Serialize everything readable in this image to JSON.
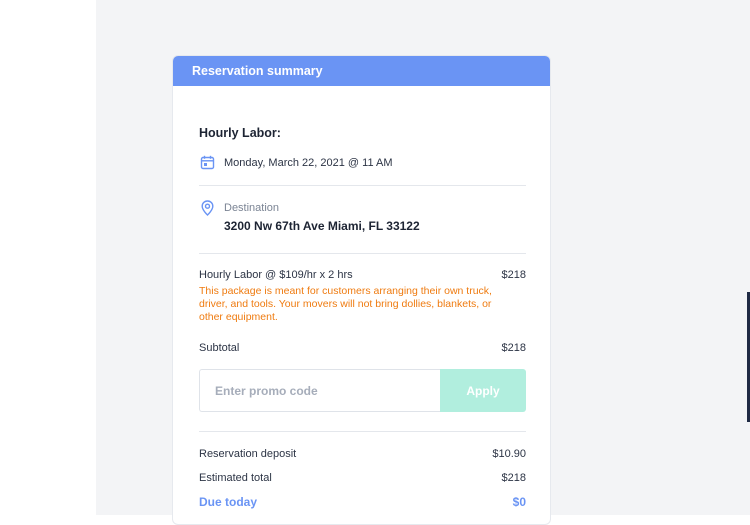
{
  "summary": {
    "header_title": "Reservation summary",
    "section_title": "Hourly Labor:",
    "date_text": "Monday, March 22, 2021  @ 11 AM",
    "destination_label": "Destination",
    "destination_address": "3200 Nw 67th Ave Miami, FL 33122",
    "line_item_label": "Hourly Labor @ $109/hr x 2 hrs",
    "line_item_value": "$218",
    "line_item_note": "This package is meant for customers arranging their own truck, driver, and tools. Your movers will not bring dollies, blankets, or other equipment.",
    "subtotal_label": "Subtotal",
    "subtotal_value": "$218",
    "promo_placeholder": "Enter promo code",
    "promo_value": "",
    "apply_label": "Apply",
    "deposit_label": "Reservation deposit",
    "deposit_value": "$10.90",
    "estimated_total_label": "Estimated total",
    "estimated_total_value": "$218",
    "due_today_label": "Due today",
    "due_today_value": "$0"
  },
  "icons": {
    "calendar": "calendar-icon",
    "location": "location-pin-icon"
  },
  "colors": {
    "accent": "#6a94f4",
    "warning": "#ef7b10",
    "apply_button": "#b1eede",
    "background": "#f3f4f6"
  }
}
